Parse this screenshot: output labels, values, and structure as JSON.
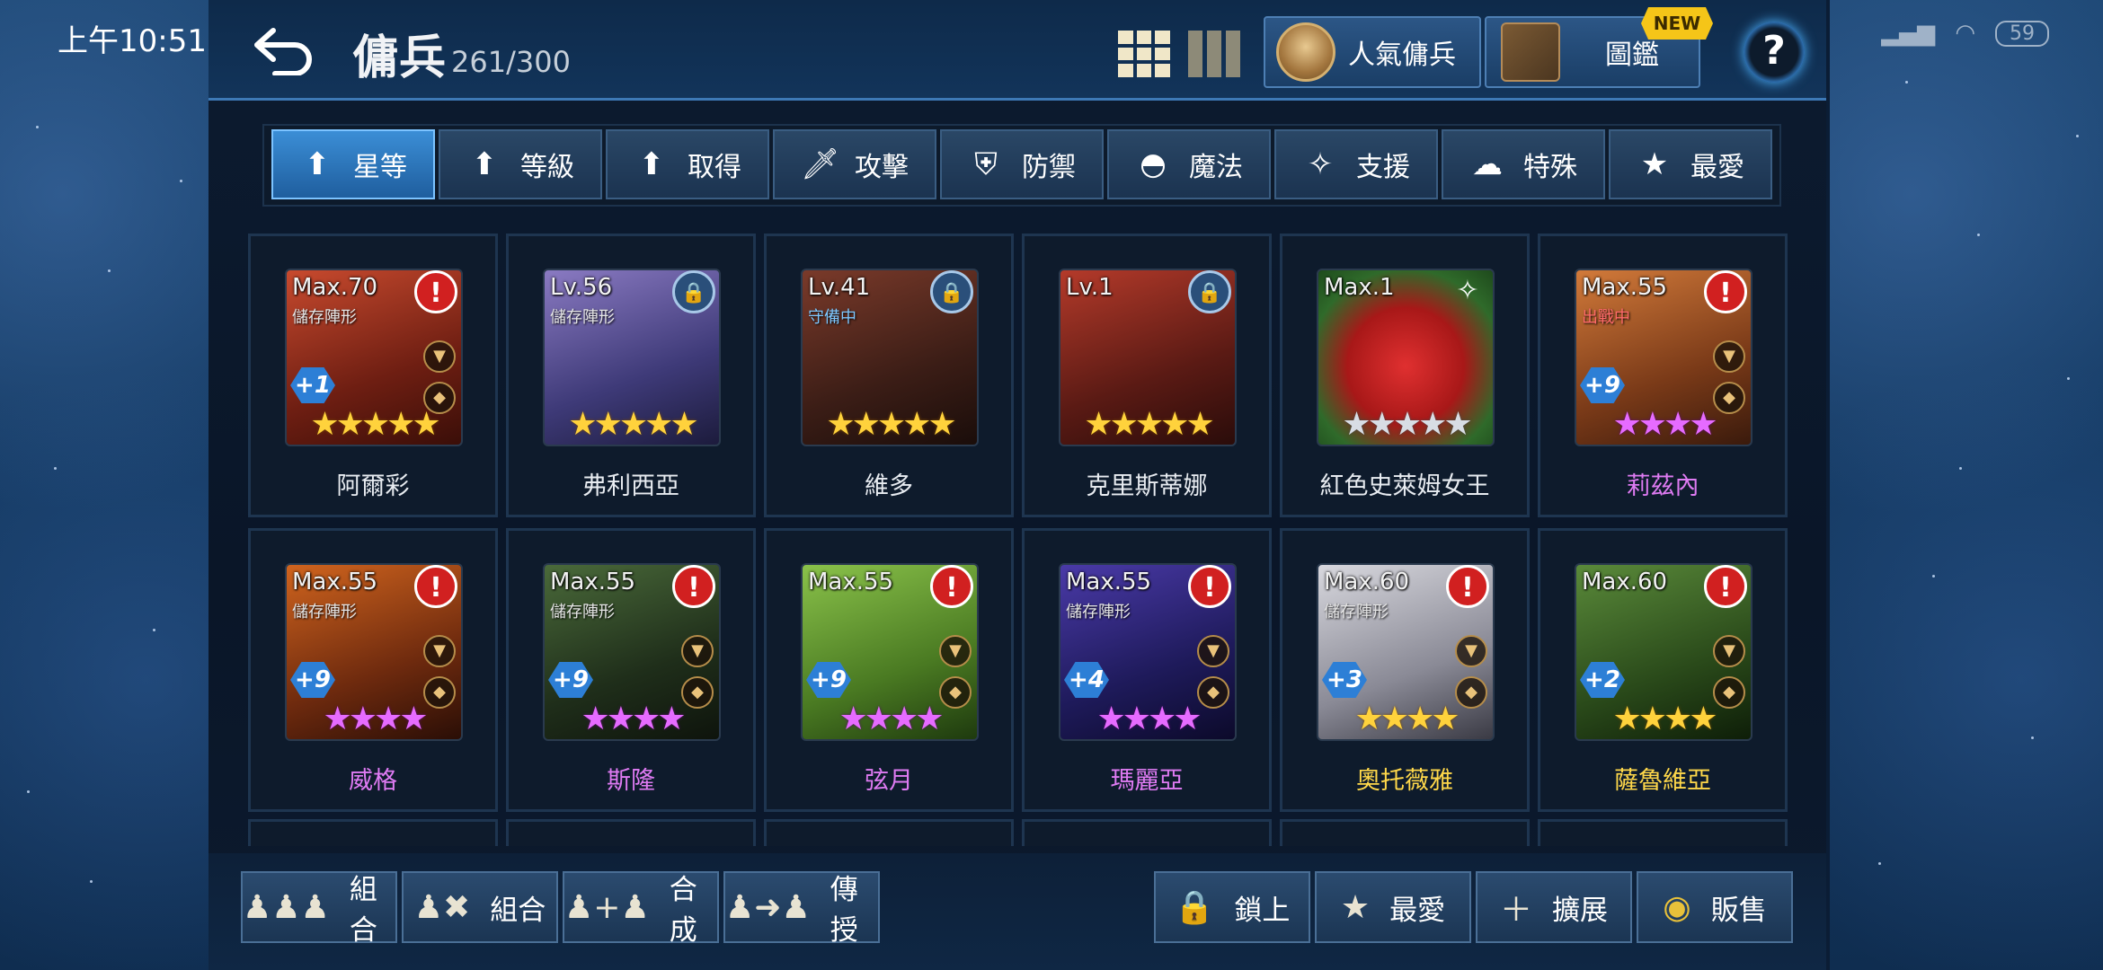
{
  "status_bar": {
    "time": "上午10:51",
    "battery": "59"
  },
  "header": {
    "title": "傭兵",
    "count": "261/300",
    "popular_label": "人氣傭兵",
    "dex_label": "圖鑑",
    "new_badge": "NEW",
    "help": "?"
  },
  "tabs": [
    {
      "label": "星等",
      "icon": "up-arrow-icon",
      "active": true
    },
    {
      "label": "等級",
      "icon": "up-arrow-icon"
    },
    {
      "label": "取得",
      "icon": "up-arrow-icon"
    },
    {
      "label": "攻擊",
      "icon": "sword-icon"
    },
    {
      "label": "防禦",
      "icon": "shield-icon"
    },
    {
      "label": "魔法",
      "icon": "magic-hat-icon"
    },
    {
      "label": "支援",
      "icon": "support-icon"
    },
    {
      "label": "特殊",
      "icon": "slime-icon"
    },
    {
      "label": "最愛",
      "icon": "star-icon"
    }
  ],
  "mercenaries": [
    {
      "name": "阿爾彩",
      "level": "Max.70",
      "sub": "儲存陣形",
      "plus": "+1",
      "stars": 5,
      "star_color": "gold",
      "name_color": "white",
      "badge": "alert"
    },
    {
      "name": "弗利西亞",
      "level": "Lv.56",
      "sub": "儲存陣形",
      "plus": "",
      "stars": 5,
      "star_color": "gold",
      "name_color": "white",
      "badge": "lock"
    },
    {
      "name": "維多",
      "level": "Lv.41",
      "sub": "守備中",
      "plus": "",
      "stars": 5,
      "star_color": "gold",
      "name_color": "white",
      "badge": "lock"
    },
    {
      "name": "克里斯蒂娜",
      "level": "Lv.1",
      "sub": "",
      "plus": "",
      "stars": 5,
      "star_color": "gold",
      "name_color": "white",
      "badge": "lock"
    },
    {
      "name": "紅色史萊姆女王",
      "level": "Max.1",
      "sub": "",
      "plus": "",
      "stars": 5,
      "star_color": "silver",
      "name_color": "white",
      "badge": "support"
    },
    {
      "name": "莉茲內",
      "level": "Max.55",
      "sub": "出戰中",
      "plus": "+9",
      "stars": 4,
      "star_color": "purple",
      "name_color": "purple",
      "badge": "alert"
    },
    {
      "name": "威格",
      "level": "Max.55",
      "sub": "儲存陣形",
      "plus": "+9",
      "stars": 4,
      "star_color": "purple",
      "name_color": "purple",
      "badge": "alert"
    },
    {
      "name": "斯隆",
      "level": "Max.55",
      "sub": "儲存陣形",
      "plus": "+9",
      "stars": 4,
      "star_color": "purple",
      "name_color": "purple",
      "badge": "alert"
    },
    {
      "name": "弦月",
      "level": "Max.55",
      "sub": "",
      "plus": "+9",
      "stars": 4,
      "star_color": "purple",
      "name_color": "purple",
      "badge": "alert"
    },
    {
      "name": "瑪麗亞",
      "level": "Max.55",
      "sub": "儲存陣形",
      "plus": "+4",
      "stars": 4,
      "star_color": "purple",
      "name_color": "purple",
      "badge": "alert"
    },
    {
      "name": "奧托薇雅",
      "level": "Max.60",
      "sub": "儲存陣形",
      "plus": "+3",
      "stars": 4,
      "star_color": "gold",
      "name_color": "gold",
      "badge": "alert"
    },
    {
      "name": "薩魯維亞",
      "level": "Max.60",
      "sub": "",
      "plus": "+2",
      "stars": 4,
      "star_color": "gold",
      "name_color": "gold",
      "badge": "alert"
    }
  ],
  "bottom_buttons": [
    {
      "label": "組合",
      "icon": "group-icon"
    },
    {
      "label": "組合",
      "icon": "ungroup-icon"
    },
    {
      "label": "合成",
      "icon": "merge-icon"
    },
    {
      "label": "傳授",
      "icon": "transfer-icon"
    },
    {
      "label": "鎖上",
      "icon": "lock-icon"
    },
    {
      "label": "最愛",
      "icon": "star-icon"
    },
    {
      "label": "擴展",
      "icon": "plus-icon"
    },
    {
      "label": "販售",
      "icon": "coin-icon"
    }
  ]
}
